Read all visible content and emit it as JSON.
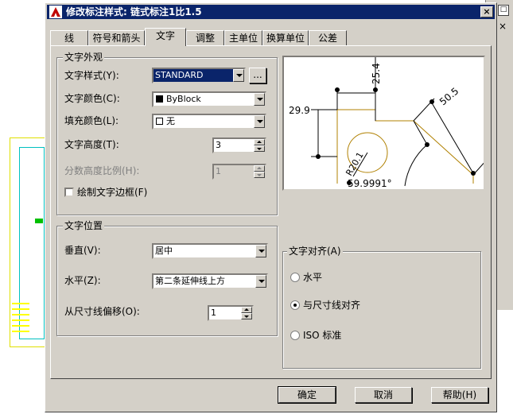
{
  "background": {
    "close_box_glyph": "□",
    "close_x": "×"
  },
  "dialog": {
    "title": "修改标注样式: 链式标注1比1.5",
    "close_glyph": "×"
  },
  "tabs": [
    {
      "label": "线"
    },
    {
      "label": "符号和箭头"
    },
    {
      "label": "文字",
      "active": true
    },
    {
      "label": "调整"
    },
    {
      "label": "主单位"
    },
    {
      "label": "换算单位"
    },
    {
      "label": "公差"
    }
  ],
  "text_appearance": {
    "title": "文字外观",
    "style_label": "文字样式(Y):",
    "style_value": "STANDARD",
    "style_browse": "...",
    "color_label": "文字颜色(C):",
    "color_value": "ByBlock",
    "fill_label": "填充颜色(L):",
    "fill_value": "无",
    "height_label": "文字高度(T):",
    "height_value": "3",
    "fraction_label": "分数高度比例(H):",
    "fraction_value": "1",
    "frame_label": "绘制文字边框(F)"
  },
  "text_placement": {
    "title": "文字位置",
    "vertical_label": "垂直(V):",
    "vertical_value": "居中",
    "horizontal_label": "水平(Z):",
    "horizontal_value": "第二条延伸线上方",
    "offset_label": "从尺寸线偏移(O):",
    "offset_value": "1"
  },
  "text_alignment": {
    "title": "文字对齐(A)",
    "options": [
      {
        "label": "水平",
        "selected": false
      },
      {
        "label": "与尺寸线对齐",
        "selected": true
      },
      {
        "label": "ISO 标准",
        "selected": false
      }
    ]
  },
  "preview": {
    "dim_top": "25.4",
    "dim_left": "29.9",
    "dim_right": "50.5",
    "dim_radius": "R20.1",
    "dim_angle": "59.9991°"
  },
  "buttons": {
    "ok": "确定",
    "cancel": "取消",
    "help": "帮助(H)"
  },
  "colors": {
    "title_bar": "#0a246a",
    "face": "#d4d0c8",
    "preview_shape": "#b08000"
  }
}
